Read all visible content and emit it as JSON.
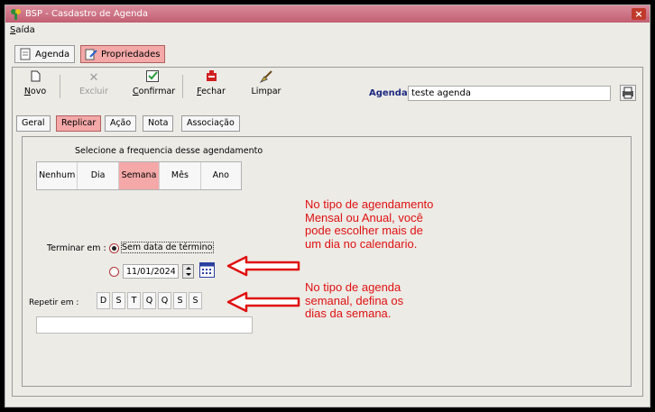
{
  "window": {
    "title": "BSP - Casdastro de Agenda",
    "close_symbol": "×"
  },
  "menu": {
    "items": [
      {
        "label_accel": "S",
        "label_rest": "aída"
      }
    ]
  },
  "tabs": [
    {
      "label": "Agenda",
      "icon": "notepad-icon",
      "active": false
    },
    {
      "label": "Propriedades",
      "icon": "edit-document-icon",
      "active": true
    }
  ],
  "toolbar": {
    "novo": {
      "accel": "N",
      "rest": "ovo",
      "icon": "new-document-icon"
    },
    "excluir": {
      "label": "Excluir",
      "icon": "delete-x-icon",
      "disabled": true
    },
    "confirmar": {
      "accel": "C",
      "rest": "onfirmar",
      "icon": "check-icon"
    },
    "fechar": {
      "accel": "F",
      "rest": "echar",
      "icon": "close-box-icon"
    },
    "limpar": {
      "label": "Limpar",
      "icon": "broom-icon"
    },
    "agenda_label": "Agenda",
    "agenda_value": "teste agenda",
    "print_icon": "printer-icon"
  },
  "subtabs": [
    {
      "label": "Geral",
      "active": false
    },
    {
      "label": "Replicar",
      "active": true
    },
    {
      "label": "Ação",
      "active": false
    },
    {
      "label": "Nota",
      "active": false
    },
    {
      "label": "Associação",
      "active": false
    }
  ],
  "frequency": {
    "label": "Selecione a frequencia desse agendamento",
    "options": [
      "Nenhum",
      "Dia",
      "Semana",
      "Mês",
      "Ano"
    ],
    "selected": "Semana"
  },
  "end": {
    "label": "Terminar em :",
    "no_end_label": "Sem data de término",
    "no_end_checked": true,
    "date_value": "11/01/2024",
    "calendar_icon": "calendar-icon"
  },
  "repeat": {
    "label": "Repetir em :",
    "days": [
      "D",
      "S",
      "T",
      "Q",
      "Q",
      "S",
      "S"
    ],
    "selected_text": ""
  },
  "annotations": {
    "calendar_note": [
      "No tipo de agendamento",
      "Mensal ou Anual, você",
      "pode escolher mais de",
      "um dia no calendario."
    ],
    "weekday_note": [
      "No tipo de agenda",
      "semanal, defina os",
      "dias da semana."
    ],
    "color": "#e01010"
  }
}
